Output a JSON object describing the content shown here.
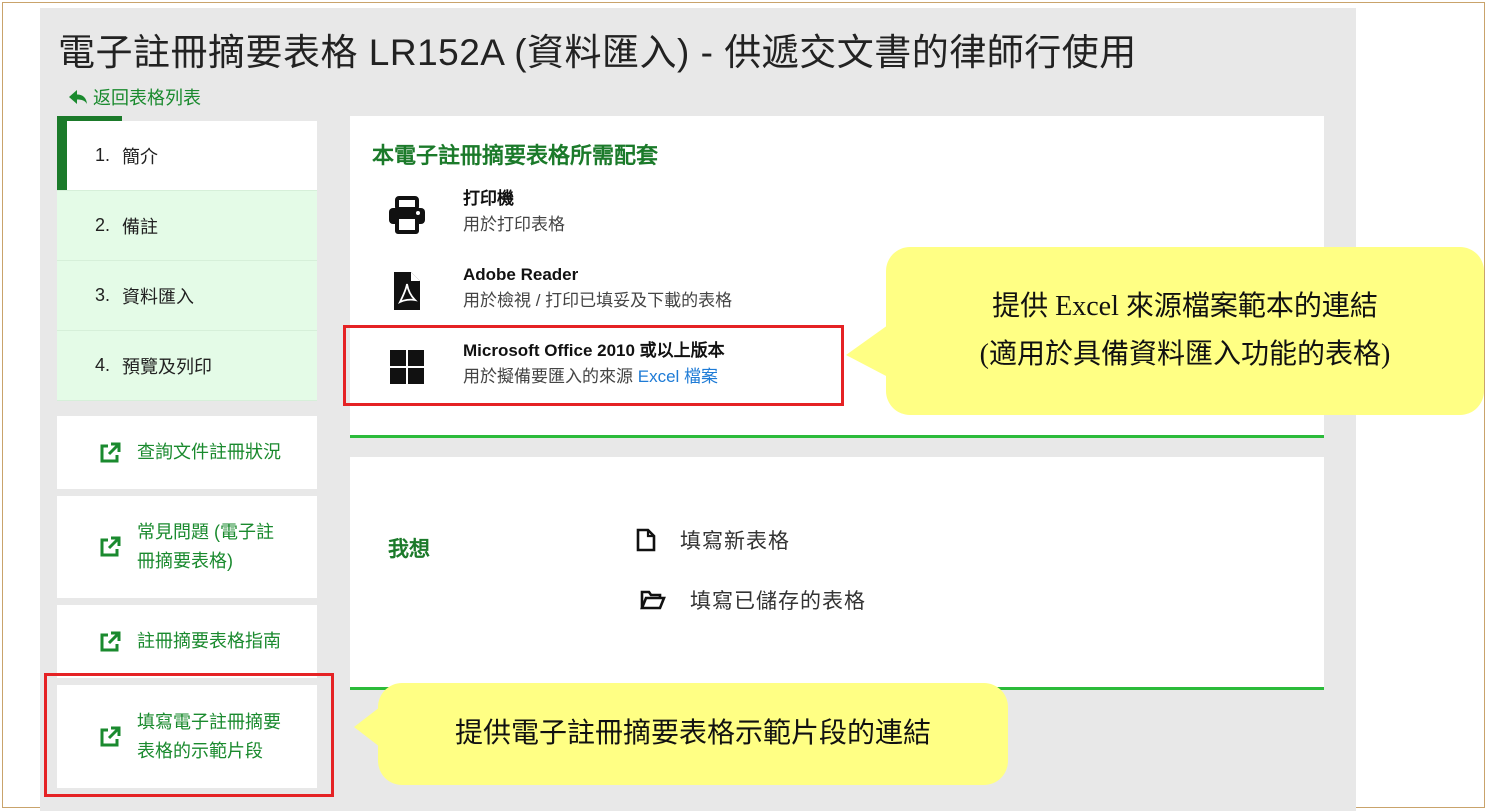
{
  "page": {
    "title": "電子註冊摘要表格 LR152A (資料匯入) - 供遞交文書的律師行使用",
    "back_link": "返回表格列表"
  },
  "sidebar": {
    "steps": [
      {
        "num": "1.",
        "label": "簡介",
        "active": true
      },
      {
        "num": "2.",
        "label": "備註",
        "active": false
      },
      {
        "num": "3.",
        "label": "資料匯入",
        "active": false
      },
      {
        "num": "4.",
        "label": "預覽及列印",
        "active": false
      }
    ],
    "links": [
      {
        "line1": "查詢文件註冊狀況",
        "line2": ""
      },
      {
        "line1": "常見問題 (電子註",
        "line2": "冊摘要表格)"
      },
      {
        "line1": "註冊摘要表格指南",
        "line2": ""
      },
      {
        "line1": "填寫電子註冊摘要",
        "line2": "表格的示範片段"
      }
    ]
  },
  "requirements": {
    "heading": "本電子註冊摘要表格所需配套",
    "items": [
      {
        "icon": "printer-icon",
        "name": "打印機",
        "desc": "用於打印表格",
        "link": ""
      },
      {
        "icon": "pdf-file-icon",
        "name": "Adobe Reader",
        "desc": "用於檢視 / 打印已填妥及下載的表格",
        "link": ""
      },
      {
        "icon": "windows-icon",
        "name": "Microsoft Office 2010 或以上版本",
        "desc": "用於擬備要匯入的來源 ",
        "link": "Excel 檔案"
      }
    ]
  },
  "actions": {
    "label": "我想",
    "options": [
      {
        "icon": "file-icon",
        "label": "填寫新表格"
      },
      {
        "icon": "folder-open-icon",
        "label": "填寫已儲存的表格"
      }
    ]
  },
  "annotations": {
    "excel_callout": {
      "line1": "提供 Excel 來源檔案範本的連結",
      "line2": "(適用於具備資料匯入功能的表格)"
    },
    "sample_callout": "提供電子註冊摘要表格示範片段的連結"
  },
  "colors": {
    "green": "#1b7a2a",
    "light_green": "#e4fbe7",
    "link_blue": "#1e7bd6",
    "highlight_red": "#e52224",
    "callout_yellow": "#ffff84"
  }
}
